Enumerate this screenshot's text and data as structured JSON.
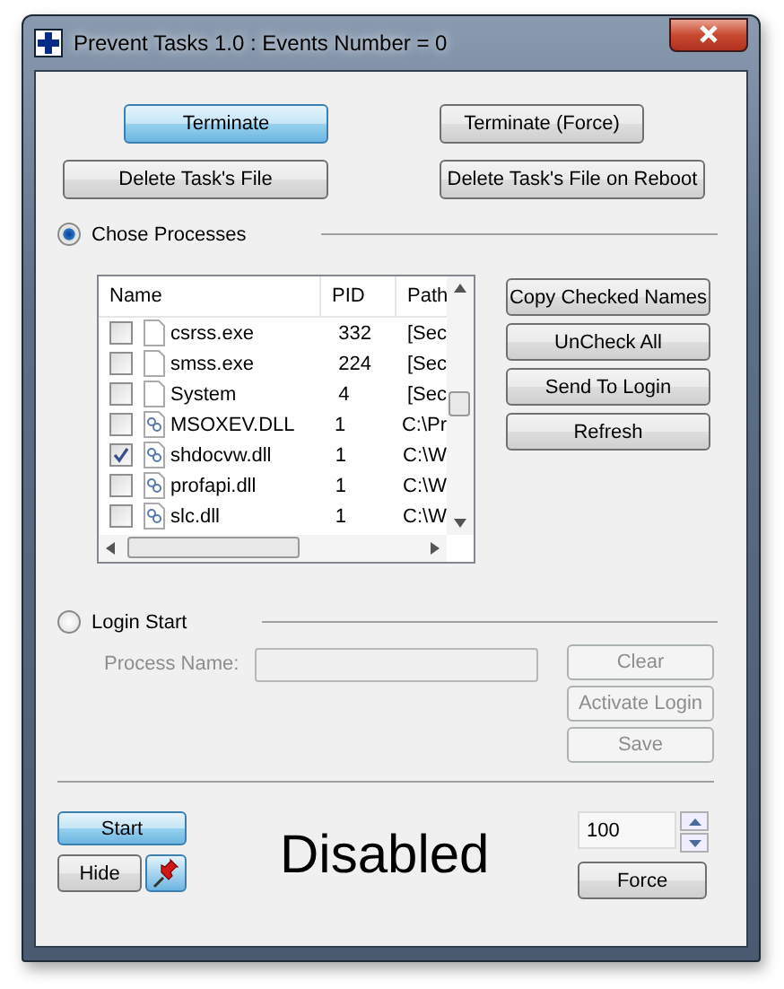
{
  "window": {
    "title": "Prevent Tasks 1.0 :  Events Number = 0"
  },
  "top_buttons": [
    {
      "label": "Terminate",
      "default": true
    },
    {
      "label": "Terminate (Force)",
      "default": false
    },
    {
      "label": "Delete Task's File",
      "default": false
    },
    {
      "label": "Delete Task's File on Reboot",
      "default": false
    }
  ],
  "modes": [
    {
      "label": "Chose Processes",
      "selected": true
    },
    {
      "label": "Login Start",
      "selected": false
    }
  ],
  "table": {
    "columns": [
      "Name",
      "PID",
      "Path"
    ],
    "rows": [
      {
        "name": "csrss.exe",
        "pid": "332",
        "path": "[Sec",
        "kind": "blank",
        "checked": false
      },
      {
        "name": "smss.exe",
        "pid": "224",
        "path": "[Sec",
        "kind": "blank",
        "checked": false
      },
      {
        "name": "System",
        "pid": "4",
        "path": "[Sec",
        "kind": "blank",
        "checked": false
      },
      {
        "name": "MSOXEV.DLL",
        "pid": "1",
        "path": "C:\\Pr",
        "kind": "dll",
        "checked": false
      },
      {
        "name": "shdocvw.dll",
        "pid": "1",
        "path": "C:\\W",
        "kind": "dll",
        "checked": true
      },
      {
        "name": "profapi.dll",
        "pid": "1",
        "path": "C:\\W",
        "kind": "dll",
        "checked": false
      },
      {
        "name": "slc.dll",
        "pid": "1",
        "path": "C:\\W",
        "kind": "dll",
        "checked": false
      }
    ]
  },
  "side_buttons": [
    "Copy Checked Names",
    "UnCheck All",
    "Send To Login",
    "Refresh"
  ],
  "login": {
    "label": "Process Name:",
    "buttons": [
      {
        "label": "Clear",
        "disabled": true
      },
      {
        "label": "Activate Login",
        "disabled": true
      },
      {
        "label": "Save",
        "disabled": true
      }
    ],
    "disabled": true
  },
  "bottom": {
    "start": "Start",
    "start_default": true,
    "hide": "Hide",
    "status": "Disabled",
    "interval": "100",
    "force": "Force"
  }
}
